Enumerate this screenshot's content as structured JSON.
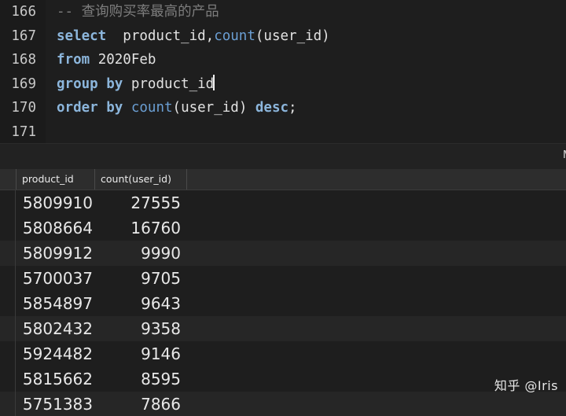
{
  "editor": {
    "lines": [
      {
        "number": "166",
        "tokens": [
          {
            "text": "-- 查询购买率最高的产品",
            "type": "comment"
          }
        ]
      },
      {
        "number": "167",
        "tokens": [
          {
            "text": "select",
            "type": "kw"
          },
          {
            "text": "  product_id,",
            "type": "plain"
          },
          {
            "text": "count",
            "type": "fn"
          },
          {
            "text": "(user_id)",
            "type": "plain"
          }
        ]
      },
      {
        "number": "168",
        "tokens": [
          {
            "text": "from",
            "type": "kw"
          },
          {
            "text": " 2020Feb",
            "type": "plain"
          }
        ]
      },
      {
        "number": "169",
        "tokens": [
          {
            "text": "group by",
            "type": "kw"
          },
          {
            "text": " product_id",
            "type": "plain"
          }
        ],
        "caret": true
      },
      {
        "number": "170",
        "tokens": [
          {
            "text": "order by",
            "type": "kw"
          },
          {
            "text": " ",
            "type": "plain"
          },
          {
            "text": "count",
            "type": "fn"
          },
          {
            "text": "(user_id) ",
            "type": "plain"
          },
          {
            "text": "desc",
            "type": "kw"
          },
          {
            "text": ";",
            "type": "plain"
          }
        ]
      },
      {
        "number": "171",
        "tokens": []
      }
    ]
  },
  "toolbar": {
    "clipped_label": "M"
  },
  "results": {
    "columns": [
      "product_id",
      "count(user_id)"
    ],
    "rows": [
      {
        "product_id": "5809910",
        "count": "27555"
      },
      {
        "product_id": "5808664",
        "count": "16760"
      },
      {
        "product_id": "5809912",
        "count": "9990"
      },
      {
        "product_id": "5700037",
        "count": "9705"
      },
      {
        "product_id": "5854897",
        "count": "9643"
      },
      {
        "product_id": "5802432",
        "count": "9358"
      },
      {
        "product_id": "5924482",
        "count": "9146"
      },
      {
        "product_id": "5815662",
        "count": "8595"
      },
      {
        "product_id": "5751383",
        "count": "7866"
      }
    ]
  },
  "watermark": {
    "text": "知乎 @Iris"
  },
  "colors": {
    "editor_background": "#1e1e1e",
    "gutter_background": "#1b1b1b",
    "line_number": "#c9c9c9",
    "comment": "#7d7d7d",
    "keyword": "#8cb6dc",
    "function": "#6b9fd4",
    "plain_text": "#e2e2e2",
    "grid_header_background": "#2d2d2d",
    "row_background": "#1e1e1e",
    "row_alt_background": "#262626",
    "cell_text": "#e8e8e8"
  }
}
